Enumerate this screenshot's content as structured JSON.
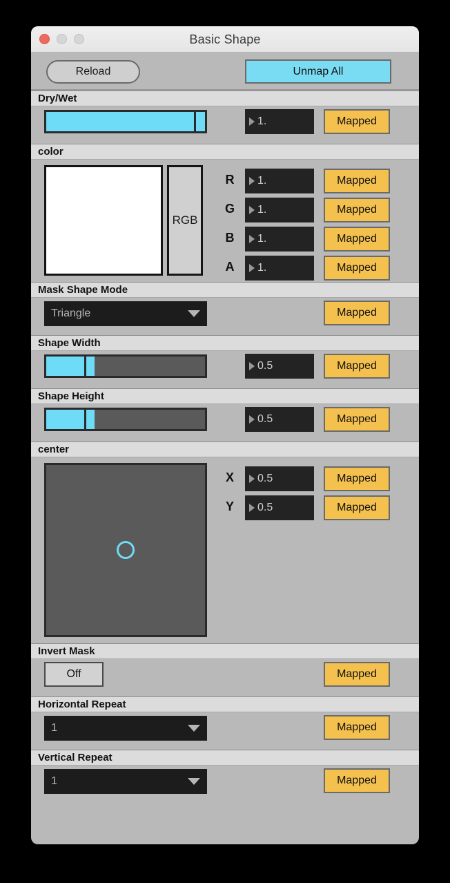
{
  "window": {
    "title": "Basic Shape",
    "traffic_lights": [
      "close-light",
      "minimize-light",
      "zoom-light"
    ]
  },
  "toolbar": {
    "reload_label": "Reload",
    "unmap_all_label": "Unmap All"
  },
  "colors": {
    "accent_cyan": "#6fdcf7",
    "mapped_amber": "#f5c14e",
    "panel_gray": "#b9b9b9",
    "header_gray": "#dcdcdc",
    "numbox_dark": "#232323",
    "track_dark": "#5a5a5a"
  },
  "mapped_label": "Mapped",
  "sections": {
    "dry_wet": {
      "header": "Dry/Wet",
      "slider": {
        "fill_percent": 93,
        "tail_percent": 7
      },
      "value": "1.",
      "mapped": "Mapped"
    },
    "color": {
      "header": "color",
      "swatch_color": "#ffffff",
      "rgb_label": "RGB",
      "channels": [
        {
          "label": "R",
          "value": "1.",
          "mapped": "Mapped"
        },
        {
          "label": "G",
          "value": "1.",
          "mapped": "Mapped"
        },
        {
          "label": "B",
          "value": "1.",
          "mapped": "Mapped"
        },
        {
          "label": "A",
          "value": "1.",
          "mapped": "Mapped"
        }
      ]
    },
    "mask_shape_mode": {
      "header": "Mask Shape Mode",
      "value": "Triangle",
      "mapped": "Mapped"
    },
    "shape_width": {
      "header": "Shape Width",
      "slider": {
        "fill_percent": 24,
        "tail_percent": 5
      },
      "value": "0.5",
      "mapped": "Mapped"
    },
    "shape_height": {
      "header": "Shape Height",
      "slider": {
        "fill_percent": 24,
        "tail_percent": 5
      },
      "value": "0.5",
      "mapped": "Mapped"
    },
    "center": {
      "header": "center",
      "pad": {
        "x_percent": 50,
        "y_percent": 50
      },
      "axes": [
        {
          "label": "X",
          "value": "0.5",
          "mapped": "Mapped"
        },
        {
          "label": "Y",
          "value": "0.5",
          "mapped": "Mapped"
        }
      ]
    },
    "invert_mask": {
      "header": "Invert Mask",
      "toggle_label": "Off",
      "mapped": "Mapped"
    },
    "horizontal_repeat": {
      "header": "Horizontal Repeat",
      "value": "1",
      "mapped": "Mapped"
    },
    "vertical_repeat": {
      "header": "Vertical Repeat",
      "value": "1",
      "mapped": "Mapped"
    }
  }
}
